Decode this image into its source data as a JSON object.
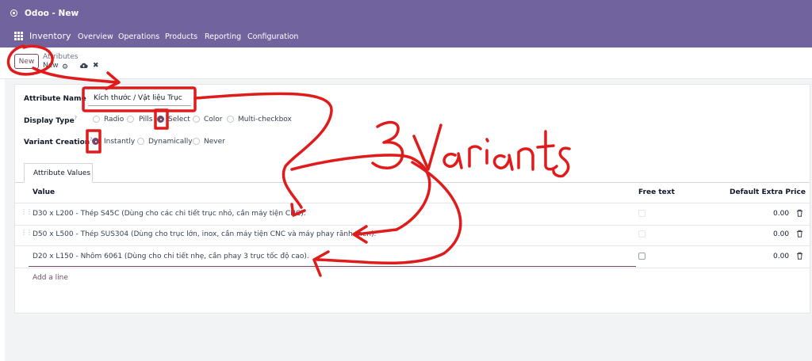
{
  "window": {
    "title": "Odoo - New"
  },
  "navbar": {
    "app_name": "Inventory",
    "menu": [
      "Overview",
      "Operations",
      "Products",
      "Reporting",
      "Configuration"
    ]
  },
  "control_panel": {
    "new_button": "New",
    "breadcrumb_parent": "Attributes",
    "breadcrumb_current": "New",
    "gear": "⚙",
    "discard": "✖"
  },
  "form": {
    "attribute_name_label": "Attribute Name",
    "attribute_name_value": "Kích thước / Vật liệu Trục",
    "display_type_label": "Display Type",
    "display_type_options": [
      "Radio",
      "Pills",
      "Select",
      "Color",
      "Multi-checkbox"
    ],
    "display_type_selected": "Select",
    "variant_creation_label": "Variant Creation",
    "variant_creation_options": [
      "Instantly",
      "Dynamically",
      "Never"
    ],
    "variant_creation_selected": "Instantly",
    "help_mark": "?"
  },
  "tabs": {
    "attribute_values": "Attribute Values"
  },
  "table": {
    "headers": {
      "value": "Value",
      "free_text": "Free text",
      "extra_price": "Default Extra Price"
    },
    "rows": [
      {
        "value": "D30 x L200 - Thép S45C (Dùng cho các chi tiết trục nhỏ, cần máy tiện CNC).",
        "free_text": false,
        "price": "0.00"
      },
      {
        "value": "D50 x L500 - Thép SUS304 (Dùng cho trục lớn, inox, cần máy tiện CNC và máy phay rãnh then).",
        "free_text": false,
        "price": "0.00"
      },
      {
        "value": "D20 x L150 - Nhôm 6061 (Dùng cho chi tiết nhẹ, cần phay 3 trục tốc độ cao).",
        "free_text": false,
        "price": "0.00"
      }
    ],
    "add_line": "Add a line"
  },
  "annotation": {
    "text": "3 Variants",
    "color": "#e01b1b"
  },
  "colors": {
    "brand": "#71639e",
    "accent": "#714b67"
  }
}
